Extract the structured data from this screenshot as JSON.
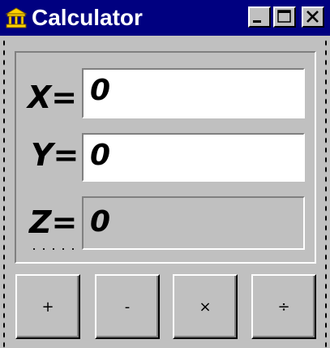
{
  "window": {
    "title": "Calculator",
    "icon": "calculator-building-icon",
    "controls": [
      "minimize-icon",
      "maximize-icon",
      "close-icon"
    ]
  },
  "fields": {
    "x": {
      "label": "X=",
      "value": "0"
    },
    "y": {
      "label": "Y=",
      "value": "0"
    },
    "z": {
      "label": "Z=",
      "value": "0"
    }
  },
  "operations": [
    "+",
    "-",
    "×",
    "÷"
  ],
  "colors": {
    "titlebar": "#000080",
    "face": "#c0c0c0",
    "field_bg": "#ffffff"
  }
}
